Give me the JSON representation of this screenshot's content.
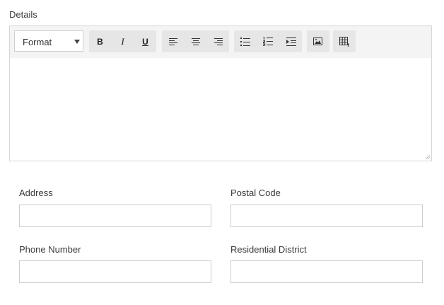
{
  "details": {
    "label": "Details",
    "toolbar": {
      "format_select": {
        "value": "Format"
      },
      "bold_label": "B",
      "italic_label": "I",
      "underline_label": "U"
    },
    "body_text": ""
  },
  "fields": {
    "address": {
      "label": "Address",
      "value": ""
    },
    "postal_code": {
      "label": "Postal Code",
      "value": ""
    },
    "phone_number": {
      "label": "Phone Number",
      "value": ""
    },
    "residential_district": {
      "label": "Residential District",
      "value": ""
    }
  }
}
